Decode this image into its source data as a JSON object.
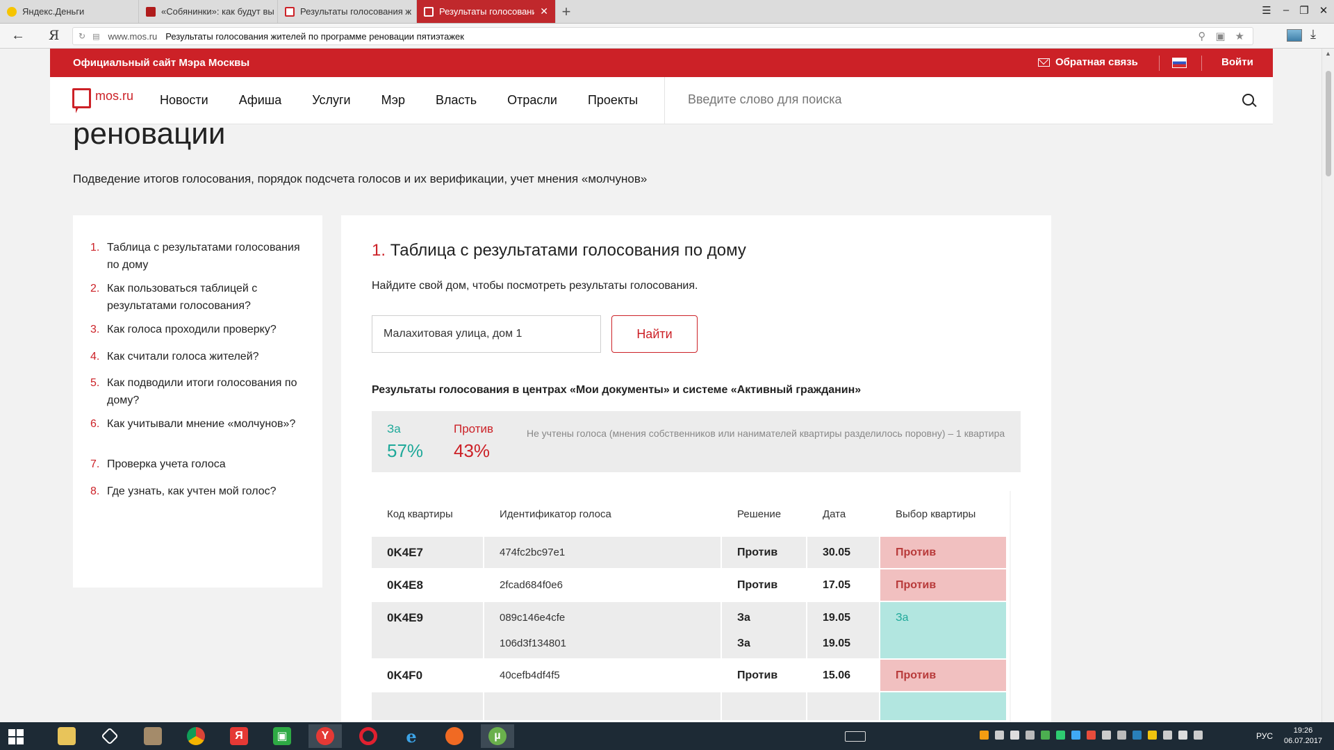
{
  "browser": {
    "tabs": [
      {
        "label": "Яндекс.Деньги",
        "favicon_color": "#f6c400",
        "active": false
      },
      {
        "label": "«Собянинки»: как будут вы",
        "favicon_color": "#b01c1c",
        "active": false
      },
      {
        "label": "Результаты голосования ж",
        "favicon_color": "#cc2127",
        "active": false
      },
      {
        "label": "Результаты голосования",
        "favicon_color": "#ffffff",
        "active": true
      }
    ],
    "new_tab_icon": "plus-icon",
    "address": {
      "domain": "www.mos.ru",
      "page_title": "Результаты голосования жителей по программе реновации пятиэтажек"
    }
  },
  "site": {
    "official_label": "Официальный сайт Мэра Москвы",
    "feedback_label": "Обратная связь",
    "login_label": "Войти",
    "logo_text": "mos.ru",
    "menu": [
      "Новости",
      "Афиша",
      "Услуги",
      "Мэр",
      "Власть",
      "Отрасли",
      "Проекты"
    ],
    "search_placeholder": "Введите слово для поиска"
  },
  "article": {
    "title_tail": "реновации",
    "subtitle": "Подведение итогов голосования, порядок подсчета голосов и их верификации, учет мнения «молчунов»",
    "toc": [
      {
        "num": "1.",
        "text": "Таблица с результатами голосования по дому"
      },
      {
        "num": "2.",
        "text": "Как пользоваться таблицей с результатами голосования?"
      },
      {
        "num": "3.",
        "text": "Как голоса проходили проверку?"
      },
      {
        "num": "4.",
        "text": "Как считали голоса жителей?"
      },
      {
        "num": "5.",
        "text": "Как подводили итоги голосования по дому?"
      },
      {
        "num": "6.",
        "text": "Как учитывали мнение «молчунов»?"
      },
      {
        "num": "7.",
        "text": "Проверка учета голоса"
      },
      {
        "num": "8.",
        "text": "Где узнать, как учтен мой голос?"
      }
    ]
  },
  "section": {
    "num": "1.",
    "title": "Таблица с результатами голосования по дому",
    "hint": "Найдите свой дом, чтобы посмотреть результаты голосования.",
    "address_value": "Малахитовая улица, дом 1",
    "find_label": "Найти",
    "results_title": "Результаты голосования в центрах «Мои документы» и системе «Активный гражданин»",
    "summary": {
      "for_label": "За",
      "for_value": "57%",
      "against_label": "Против",
      "against_value": "43%",
      "note": "Не учтены голоса (мнения собственников или нанимателей квартиры разделилось поровну) – 1 квартира"
    },
    "table": {
      "headers": [
        "Код квартиры",
        "Идентификатор голоса",
        "Решение",
        "Дата",
        "Выбор квартиры"
      ],
      "rows": [
        {
          "code": "0K4E7",
          "votes": [
            {
              "id": "474fc2bc97e1",
              "decision": "Против",
              "date": "30.05"
            }
          ],
          "choice": "Против"
        },
        {
          "code": "0K4E8",
          "votes": [
            {
              "id": "2fcad684f0e6",
              "decision": "Против",
              "date": "17.05"
            }
          ],
          "choice": "Против"
        },
        {
          "code": "0K4E9",
          "votes": [
            {
              "id": "089c146e4cfe",
              "decision": "За",
              "date": "19.05"
            },
            {
              "id": "106d3f134801",
              "decision": "За",
              "date": "19.05"
            }
          ],
          "choice": "За"
        },
        {
          "code": "0K4F0",
          "votes": [
            {
              "id": "40cefb4df4f5",
              "decision": "Против",
              "date": "15.06"
            }
          ],
          "choice": "Против"
        }
      ]
    }
  },
  "taskbar": {
    "apps": [
      "file-explorer-icon",
      "app-icon",
      "archive-icon",
      "chrome-icon",
      "yandex-icon",
      "store-icon",
      "yandex-browser-icon",
      "opera-icon",
      "ie-icon",
      "media-icon",
      "torrent-icon"
    ],
    "language": "РУС",
    "time": "19:26",
    "date": "06.07.2017"
  }
}
